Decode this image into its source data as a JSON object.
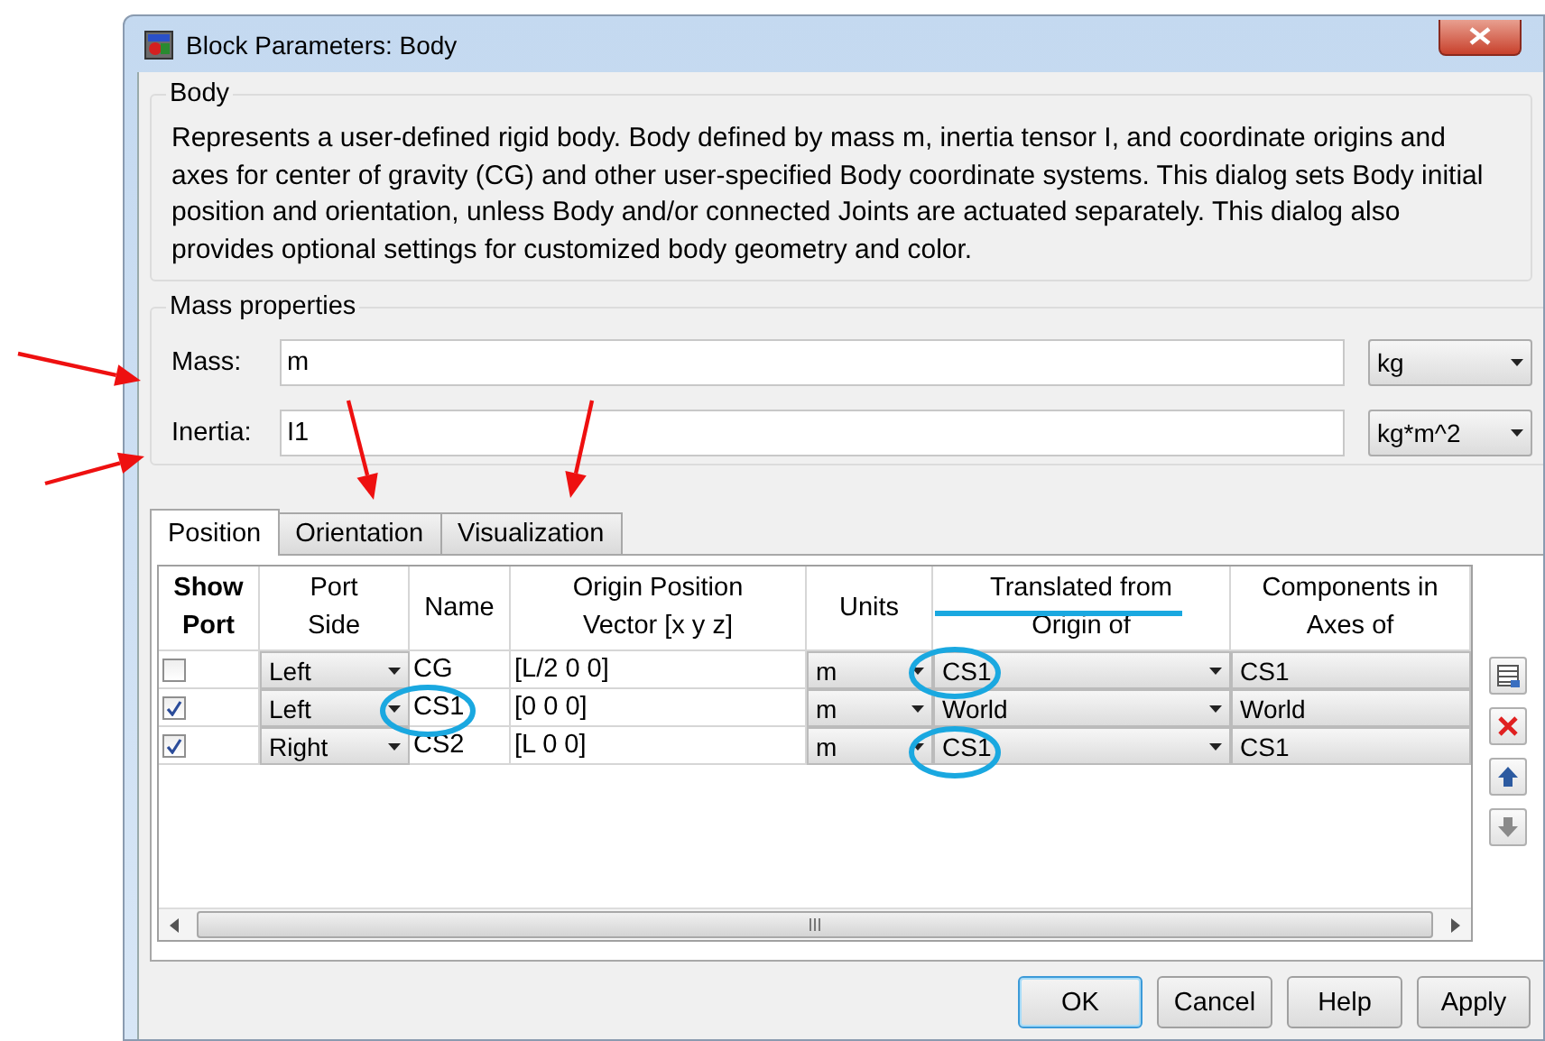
{
  "window": {
    "title": "Block Parameters: Body"
  },
  "description": {
    "title": "Body",
    "text": "Represents a user-defined rigid body. Body defined by mass m, inertia tensor I, and coordinate origins and axes for center of gravity (CG) and other user-specified Body coordinate systems. This dialog sets Body initial position and orientation, unless Body and/or connected Joints are actuated separately. This dialog also provides optional settings for customized body geometry and color."
  },
  "mass_properties": {
    "title": "Mass properties",
    "fields": [
      {
        "label": "Mass:",
        "value": "m",
        "unit": "kg"
      },
      {
        "label": "Inertia:",
        "value": "I1",
        "unit": "kg*m^2"
      }
    ]
  },
  "tabs": [
    {
      "label": "Position",
      "selected": true
    },
    {
      "label": "Orientation",
      "selected": false
    },
    {
      "label": "Visualization",
      "selected": false
    }
  ],
  "table": {
    "columns": [
      "Show\nPort",
      "Port\nSide",
      "Name",
      "Origin Position\nVector [x y z]",
      "Units",
      "Translated from\nOrigin of",
      "Components in\nAxes of"
    ],
    "rows": [
      {
        "show_port": false,
        "port_side": "Left",
        "name": "CG",
        "origin_position": "[L/2 0 0]",
        "units": "m",
        "translated_from": "CS1",
        "components_in": "CS1"
      },
      {
        "show_port": true,
        "port_side": "Left",
        "name": "CS1",
        "origin_position": "[0 0 0]",
        "units": "m",
        "translated_from": "World",
        "components_in": "World"
      },
      {
        "show_port": true,
        "port_side": "Right",
        "name": "CS2",
        "origin_position": "[L 0 0]",
        "units": "m",
        "translated_from": "CS1",
        "components_in": "CS1"
      }
    ]
  },
  "buttons": [
    {
      "label": "OK",
      "default": true
    },
    {
      "label": "Cancel",
      "default": false
    },
    {
      "label": "Help",
      "default": false
    },
    {
      "label": "Apply",
      "default": false
    }
  ]
}
